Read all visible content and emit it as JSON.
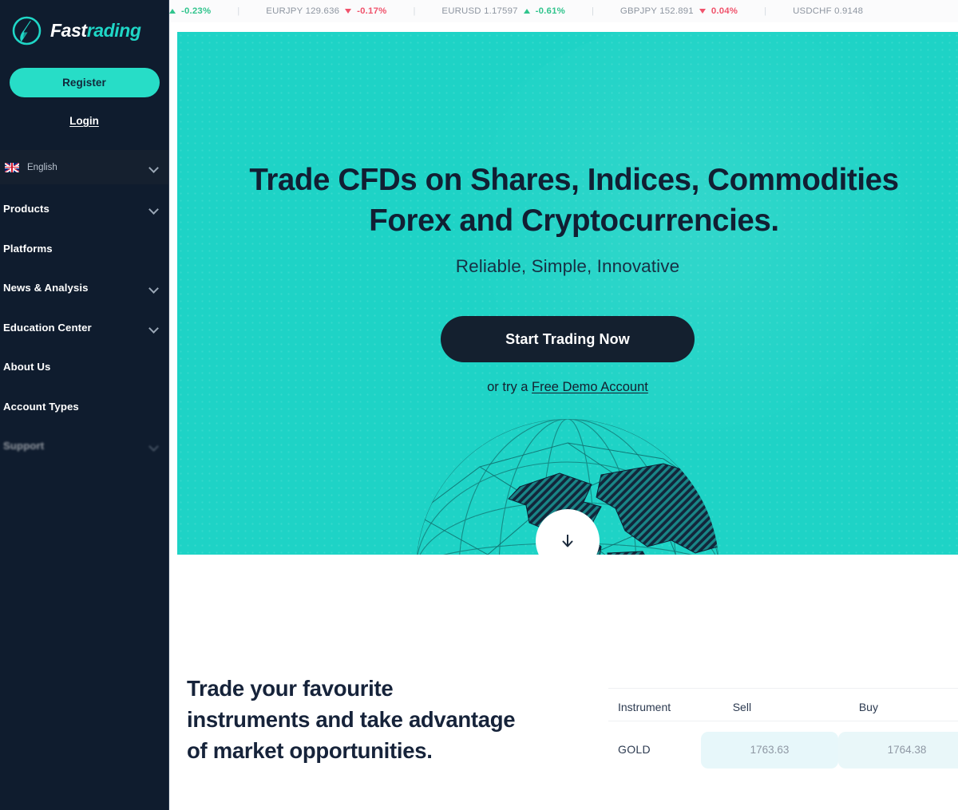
{
  "brand": {
    "name_part1": "Fast",
    "name_part2": "rading",
    "logo_icon": "fastrading-f-bolt-logo",
    "accent_color": "#1fd6c6",
    "dark_color": "#0f1c2e"
  },
  "sidebar": {
    "register_label": "Register",
    "login_label": "Login",
    "language": {
      "flag_icon": "uk-flag-icon",
      "label": "English",
      "chevron_icon": "chevron-down-icon"
    },
    "items": [
      {
        "label": "Products",
        "has_chevron": true,
        "faded": false
      },
      {
        "label": "Platforms",
        "has_chevron": false,
        "faded": false
      },
      {
        "label": "News & Analysis",
        "has_chevron": true,
        "faded": false
      },
      {
        "label": "Education Center",
        "has_chevron": true,
        "faded": false
      },
      {
        "label": "About Us",
        "has_chevron": false,
        "faded": false
      },
      {
        "label": "Account Types",
        "has_chevron": false,
        "faded": false
      },
      {
        "label": "Support",
        "has_chevron": true,
        "faded": true
      }
    ]
  },
  "ticker": {
    "items": [
      {
        "name": "",
        "pct": "-0.23%",
        "dir": "up",
        "partial": true
      },
      {
        "name": "EURJPY 129.636",
        "pct": "-0.17%",
        "dir": "down",
        "partial": false
      },
      {
        "name": "EURUSD 1.17597",
        "pct": "-0.61%",
        "dir": "up",
        "partial": false
      },
      {
        "name": "GBPJPY 152.891",
        "pct": "0.04%",
        "dir": "down",
        "partial": false
      },
      {
        "name": "USDCHF 0.9148",
        "pct": "",
        "dir": "none",
        "partial": true
      }
    ],
    "separator": "|",
    "up_color": "#31c48d",
    "down_color": "#f0536c"
  },
  "hero": {
    "bg_color": "#1ed3c6",
    "title_line1": "Trade CFDs on Shares, Indices, Commodities",
    "title_line2": "Forex and Cryptocurrencies.",
    "subtitle": "Reliable, Simple, Innovative",
    "cta_label": "Start Trading Now",
    "demo_prefix": "or try a ",
    "demo_link_label": "Free Demo Account",
    "globe_icon": "wireframe-globe-illustration",
    "scroll_icon": "arrow-down-icon"
  },
  "lower": {
    "heading_line1": "Trade your favourite",
    "heading_line2": "instruments and take advantage",
    "heading_line3": "of market opportunities.",
    "table": {
      "columns": [
        "Instrument",
        "Sell",
        "Buy"
      ],
      "rows": [
        {
          "instrument": "GOLD",
          "sell": "1763.63",
          "buy": "1764.38"
        }
      ],
      "pill_color": "#e7f7fa"
    }
  }
}
